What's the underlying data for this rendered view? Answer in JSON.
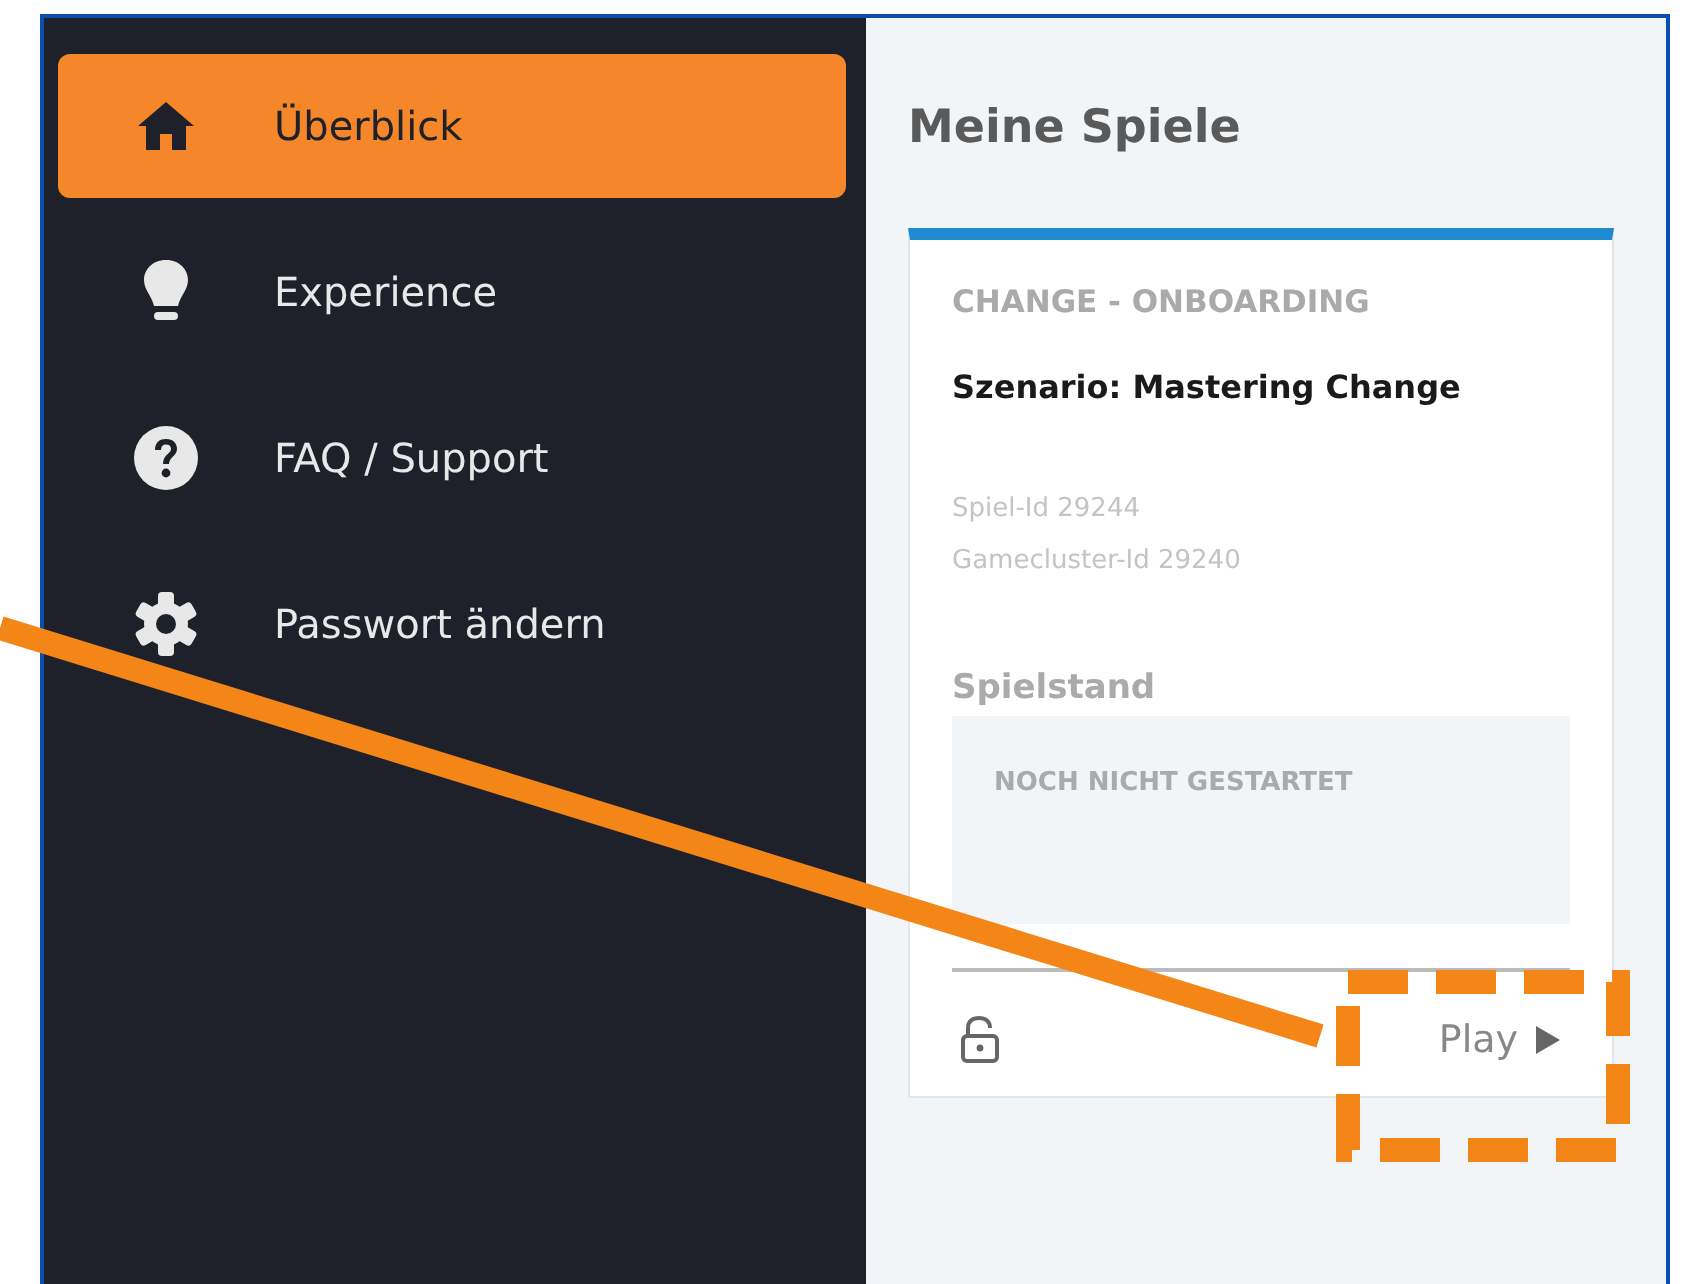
{
  "sidebar": {
    "items": [
      {
        "label": "Überblick",
        "selected": true
      },
      {
        "label": "Experience",
        "selected": false
      },
      {
        "label": "FAQ / Support",
        "selected": false
      },
      {
        "label": "Passwort ändern",
        "selected": false
      }
    ]
  },
  "main": {
    "title": "Meine Spiele",
    "games": [
      {
        "category": "CHANGE - ONBOARDING",
        "title": "Szenario: Mastering Change",
        "ids": [
          "Spiel-Id 29244",
          "Gamecluster-Id 29240"
        ],
        "progress_label": "Spielstand",
        "status": "NOCH NICHT GESTARTET",
        "play_label": "Play"
      }
    ]
  }
}
